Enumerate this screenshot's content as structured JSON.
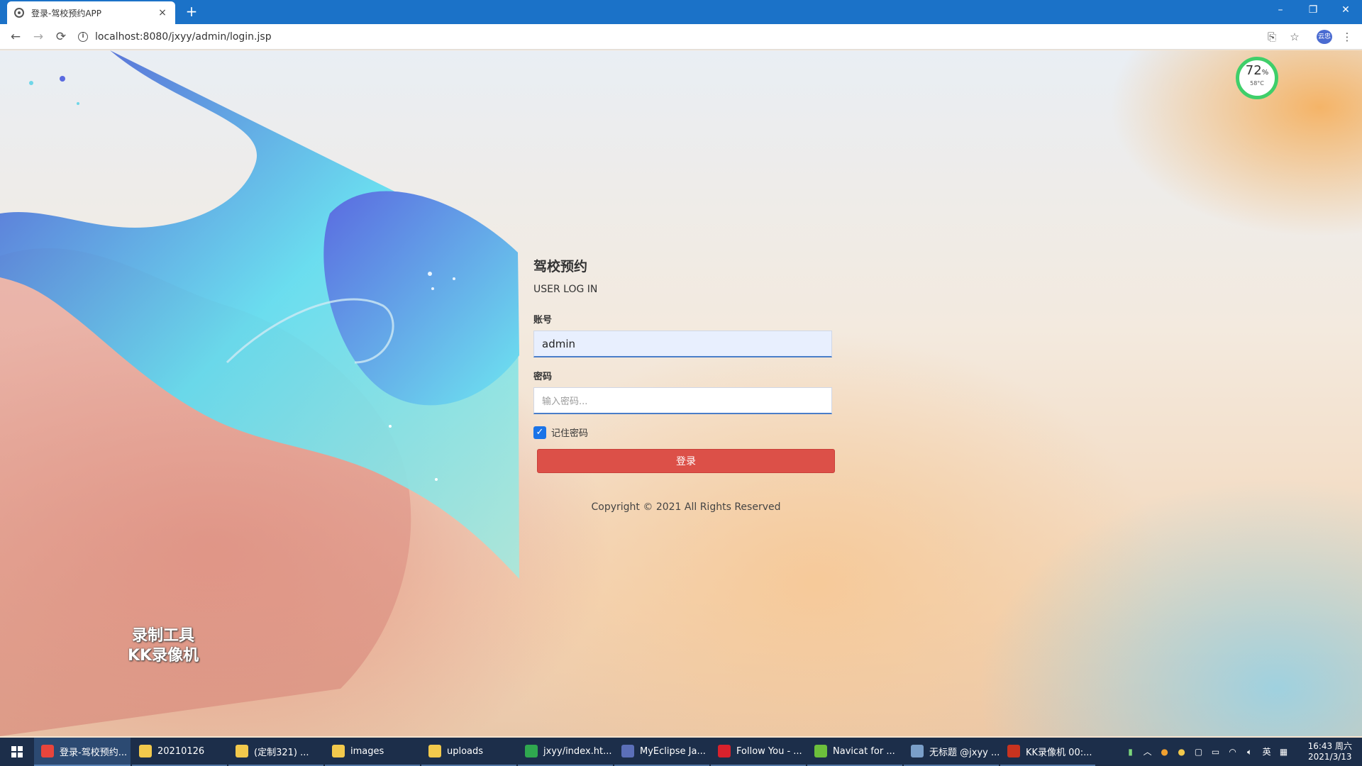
{
  "browser": {
    "tab_title": "登录-驾校预约APP",
    "tab_close": "×",
    "new_tab": "+",
    "url": "localhost:8080/jxyy/admin/login.jsp",
    "window_controls": {
      "minimize": "–",
      "restore": "❐",
      "close": "✕"
    },
    "nav": {
      "back": "←",
      "forward": "→",
      "reload": "⟳"
    },
    "icons": [
      "translate-icon",
      "star-icon",
      "profile-avatar",
      "menu-icon"
    ],
    "profile_text": "云忠"
  },
  "widget": {
    "percent": "72",
    "percent_unit": "%",
    "temp": "58°C"
  },
  "watermark": {
    "line1": "录制工具",
    "line2": "KK录像机"
  },
  "login": {
    "title": "驾校预约",
    "subtitle": "USER LOG IN",
    "account_label": "账号",
    "account_value": "admin",
    "password_label": "密码",
    "password_placeholder": "输入密码...",
    "remember_label": "记住密码",
    "remember_checked": true,
    "submit_label": "登录",
    "copyright": "Copyright © 2021 All Rights Reserved"
  },
  "taskbar": {
    "items": [
      {
        "label": "登录-驾校预约...",
        "icon": "chrome-icon",
        "color": "#e8453c",
        "active": true
      },
      {
        "label": "20210126",
        "icon": "folder-icon",
        "color": "#f2c94c"
      },
      {
        "label": "(定制321) ...",
        "icon": "folder-icon",
        "color": "#f2c94c"
      },
      {
        "label": "images",
        "icon": "folder-icon",
        "color": "#f2c94c"
      },
      {
        "label": "uploads",
        "icon": "folder-icon",
        "color": "#f2c94c"
      },
      {
        "label": "jxyy/index.ht...",
        "icon": "hbuilder-icon",
        "color": "#2fa84f"
      },
      {
        "label": "MyEclipse Ja...",
        "icon": "eclipse-icon",
        "color": "#5b6fb8"
      },
      {
        "label": "Follow You - ...",
        "icon": "netease-music-icon",
        "color": "#d8212c"
      },
      {
        "label": "Navicat for ...",
        "icon": "navicat-icon",
        "color": "#6cbf3c"
      },
      {
        "label": "无标题 @jxyy ...",
        "icon": "navicat-query-icon",
        "color": "#7a9fc9"
      },
      {
        "label": "KK录像机 00:...",
        "icon": "kk-recorder-icon",
        "color": "#c8331f"
      }
    ],
    "tray_ime": "英",
    "time": "16:43 周六",
    "date": "2021/3/13"
  }
}
